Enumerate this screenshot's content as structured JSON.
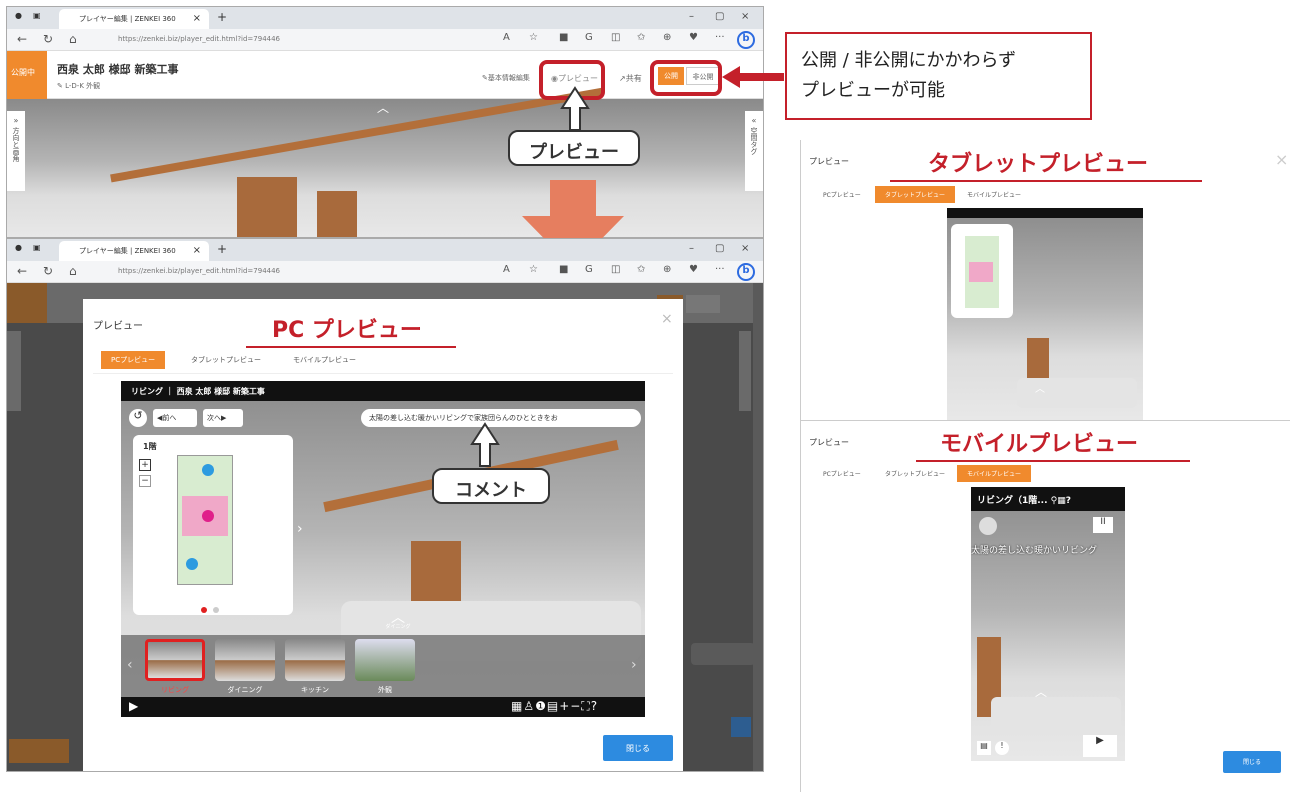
{
  "browser": {
    "tab_title": "プレイヤー編集 | ZENKEI 360",
    "url": "https://zenkei.biz/player_edit.html?id=794446"
  },
  "top_window": {
    "status_badge": "公開中",
    "project_title": "西泉 太郎 様邸 新築工事",
    "subtitle": "L-D-K 外観",
    "menu_basic": "基本情報編集",
    "menu_preview": "プレビュー",
    "menu_share": "共有",
    "btn_public": "公開",
    "btn_private": "非公開",
    "left_side_label": "方向と画角",
    "right_side_label": "空間タグ"
  },
  "annotations": {
    "preview_callout": "プレビュー",
    "public_note_line1": "公開 / 非公開にかかわらず",
    "public_note_line2": "プレビューが可能",
    "pc_preview_title": "PC プレビュー",
    "tablet_preview_title": "タブレットプレビュー",
    "mobile_preview_title": "モバイルプレビュー",
    "comment_callout": "コメント"
  },
  "preview_modal": {
    "header": "プレビュー",
    "tabs": [
      "PCプレビュー",
      "タブレットプレビュー",
      "モバイルプレビュー"
    ],
    "player_title": "リビング ｜ 西泉 太郎 様邸 新築工事",
    "nav_prev": "前へ",
    "nav_next": "次へ",
    "comment_text": "太陽の差し込む暖かいリビングで家族団らんのひとときをお",
    "floor_label": "1階",
    "hotspot_label": "ダイニング",
    "thumbnails": [
      "リビング",
      "ダイニング",
      "キッチン",
      "外観"
    ],
    "close_button": "閉じる"
  },
  "tablet_panel": {
    "header": "プレビュー",
    "tabs": [
      "PCプレビュー",
      "タブレットプレビュー",
      "モバイルプレビュー"
    ]
  },
  "mobile_panel": {
    "header": "プレビュー",
    "tabs": [
      "PCプレビュー",
      "タブレットプレビュー",
      "モバイルプレビュー"
    ],
    "player_title": "リビング（1階...",
    "comment_text": "太陽の差し込む暖かいリビング",
    "close_button": "閉じる"
  },
  "colors": {
    "accent_orange": "#f08a2d",
    "annotation_red": "#c4202a",
    "arrow_salmon": "#e67e5f",
    "button_blue": "#2d8be0"
  }
}
